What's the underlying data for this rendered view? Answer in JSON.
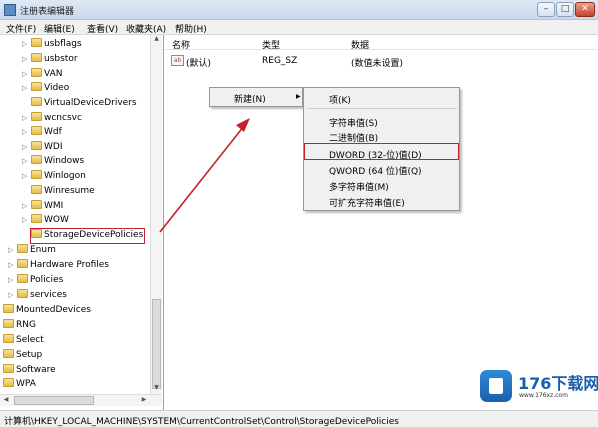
{
  "window": {
    "title": "注册表编辑器",
    "minimize": "–",
    "maximize": "□",
    "close": "✕"
  },
  "menu": [
    "文件(F)",
    "编辑(E)",
    "查看(V)",
    "收藏夹(A)",
    "帮助(H)"
  ],
  "tree": {
    "items": [
      {
        "label": "usbflags",
        "arrow": "▷"
      },
      {
        "label": "usbstor",
        "arrow": "▷"
      },
      {
        "label": "VAN",
        "arrow": "▷"
      },
      {
        "label": "Video",
        "arrow": "▷"
      },
      {
        "label": "VirtualDeviceDrivers",
        "arrow": ""
      },
      {
        "label": "wcncsvc",
        "arrow": "▷"
      },
      {
        "label": "Wdf",
        "arrow": "▷"
      },
      {
        "label": "WDI",
        "arrow": "▷"
      },
      {
        "label": "Windows",
        "arrow": "▷"
      },
      {
        "label": "Winlogon",
        "arrow": "▷"
      },
      {
        "label": "Winresume",
        "arrow": ""
      },
      {
        "label": "WMI",
        "arrow": "▷"
      },
      {
        "label": "WOW",
        "arrow": "▷"
      },
      {
        "label": "StorageDevicePolicies",
        "arrow": ""
      },
      {
        "label": "Enum",
        "arrow": "▷"
      },
      {
        "label": "Hardware Profiles",
        "arrow": "▷"
      },
      {
        "label": "Policies",
        "arrow": "▷"
      },
      {
        "label": "services",
        "arrow": "▷"
      },
      {
        "label": "MountedDevices",
        "arrow": ""
      },
      {
        "label": "RNG",
        "arrow": ""
      },
      {
        "label": "Select",
        "arrow": ""
      },
      {
        "label": "Setup",
        "arrow": "▷"
      },
      {
        "label": "Software",
        "arrow": "▷"
      },
      {
        "label": "WPA",
        "arrow": "▷"
      }
    ]
  },
  "list": {
    "headers": {
      "name": "名称",
      "type": "类型",
      "data": "数据"
    },
    "rows": [
      {
        "icon": "ab",
        "name": "(默认)",
        "type": "REG_SZ",
        "data": "(数值未设置)"
      }
    ]
  },
  "context_menu": {
    "new_label": "新建(N)",
    "sub_arrow": "▶",
    "submenu": [
      "项(K)",
      "字符串值(S)",
      "二进制值(B)",
      "DWORD (32-位)值(D)",
      "QWORD (64 位)值(Q)",
      "多字符串值(M)",
      "可扩充字符串值(E)"
    ]
  },
  "status": {
    "path": "计算机\\HKEY_LOCAL_MACHINE\\SYSTEM\\CurrentControlSet\\Control\\StorageDevicePolicies"
  },
  "watermark": {
    "main": "176下载网",
    "sub": "www.176xz.com"
  },
  "colors": {
    "annotation_red": "#c8202a",
    "selection_accent": "#1a5fae"
  }
}
